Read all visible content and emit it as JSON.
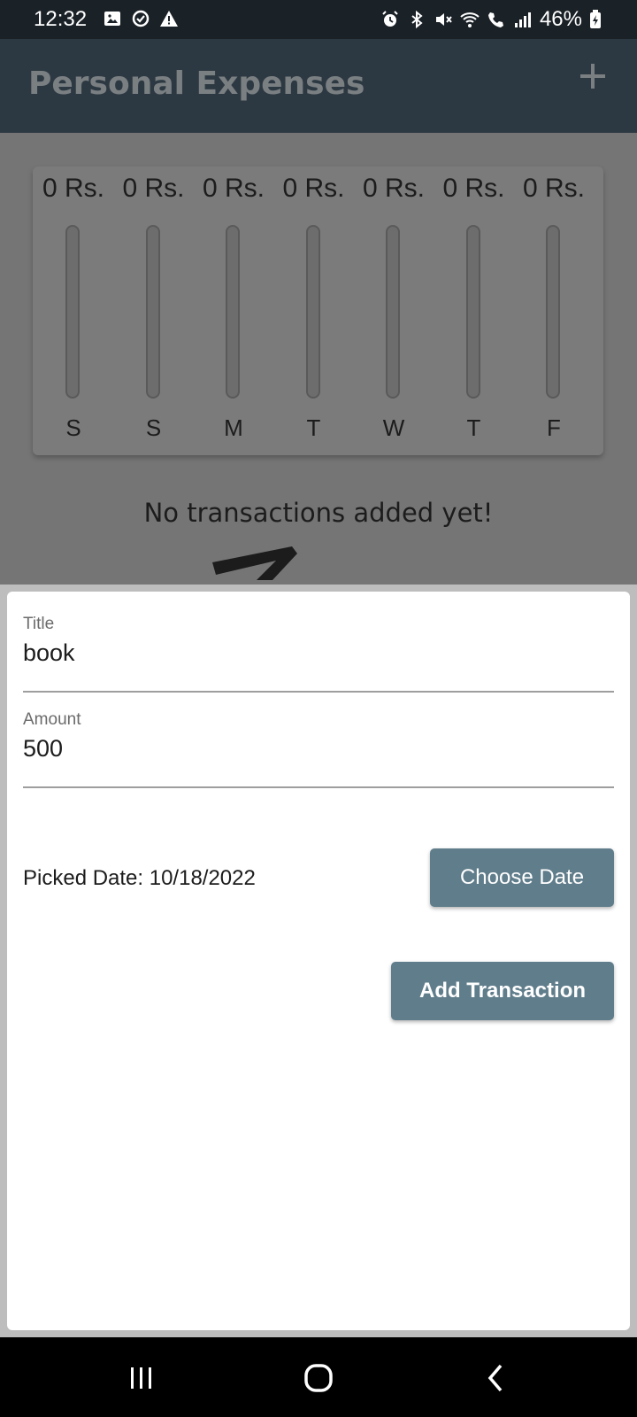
{
  "status": {
    "time": "12:32",
    "battery": "46%"
  },
  "app": {
    "title": "Personal Expenses",
    "add_icon": "plus-icon"
  },
  "chart_data": {
    "type": "bar",
    "categories": [
      "S",
      "S",
      "M",
      "T",
      "W",
      "T",
      "F"
    ],
    "values": [
      0,
      0,
      0,
      0,
      0,
      0,
      0
    ],
    "value_labels": [
      "0 Rs.",
      "0 Rs.",
      "0 Rs.",
      "0 Rs.",
      "0 Rs.",
      "0 Rs.",
      "0 Rs."
    ]
  },
  "empty": {
    "message": "No transactions added yet!"
  },
  "form": {
    "title_label": "Title",
    "title_value": "book",
    "amount_label": "Amount",
    "amount_value": "500",
    "picked_date": "Picked Date: 10/18/2022",
    "choose_date_label": "Choose Date",
    "add_transaction_label": "Add Transaction"
  },
  "colors": {
    "button": "#607d8b",
    "app_bar": "#2d3942"
  }
}
